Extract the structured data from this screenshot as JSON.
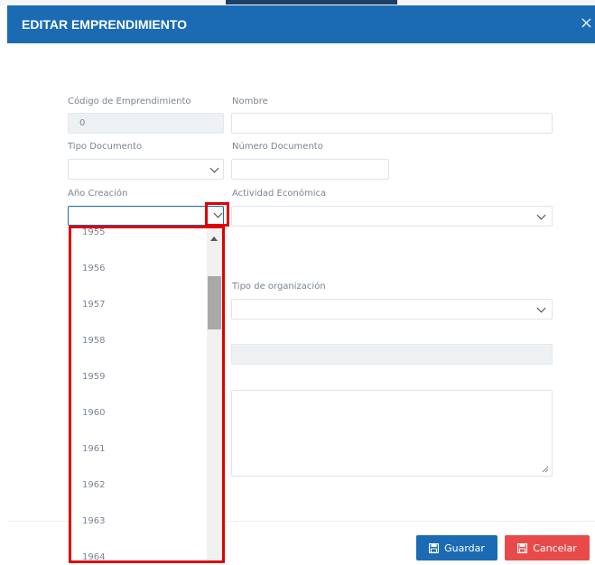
{
  "modal": {
    "title": "EDITAR EMPRENDIMIENTO",
    "close_glyph": "×"
  },
  "form": {
    "codigo": {
      "label": "Código de Emprendimiento",
      "value": "0"
    },
    "nombre": {
      "label": "Nombre",
      "value": ""
    },
    "tipo_documento": {
      "label": "Tipo Documento",
      "value": ""
    },
    "numero_documento": {
      "label": "Número Documento",
      "value": ""
    },
    "anio_creacion": {
      "label": "Año Creación",
      "value": ""
    },
    "actividad_economica": {
      "label": "Actividad Económica",
      "value": ""
    },
    "tipo_organizacion": {
      "label": "Tipo de organización",
      "value": ""
    }
  },
  "dropdown": {
    "options": [
      "1955",
      "1956",
      "1957",
      "1958",
      "1959",
      "1960",
      "1961",
      "1962",
      "1963",
      "1964"
    ]
  },
  "footer": {
    "save_label": "Guardar",
    "cancel_label": "Cancelar"
  },
  "colors": {
    "header": "#1a6bb3",
    "save": "#1a6bb3",
    "cancel": "#e84a4a",
    "highlight": "#e00000"
  },
  "icons": [
    "close-icon",
    "chevron-down-icon",
    "save-icon",
    "scroll-up-icon"
  ]
}
